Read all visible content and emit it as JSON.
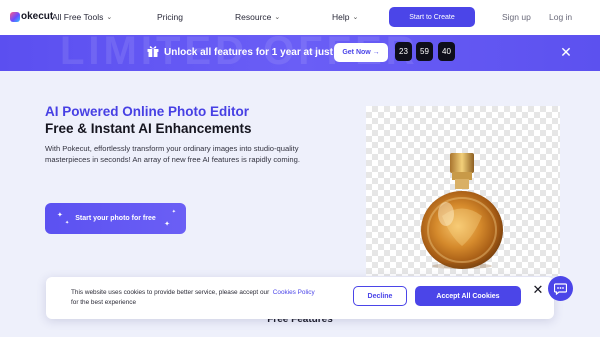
{
  "nav": {
    "logo_text": "okecut",
    "tools_label": "All Free Tools",
    "pricing_label": "Pricing",
    "resource_label": "Resource",
    "help_label": "Help",
    "create_label": "Start to Create",
    "signup_label": "Sign up",
    "login_label": "Log in"
  },
  "promo": {
    "ghost_text": "LIMITED OFFER",
    "text": "Unlock all features for 1 year at just $1!",
    "button_label": "Get Now →",
    "countdown": [
      "23",
      "59",
      "40"
    ]
  },
  "hero": {
    "title": "AI Powered Online Photo Editor",
    "subtitle": "Free & Instant AI Enhancements",
    "description": "With Pokecut, effortlessly transform your ordinary images into studio-quality masterpieces in seconds! An array of new free AI features is rapidly coming.",
    "start_label": "Start your photo for free"
  },
  "features_title": "Free Features",
  "cookie": {
    "text_before": "This website uses cookies to provide better service, please accept our",
    "link": "Cookies Policy",
    "text_after": "for the best experience",
    "decline_label": "Decline",
    "accept_label": "Accept All Cookies"
  },
  "colors": {
    "accent": "#4b45e8",
    "banner": "#5b4ff0",
    "page_bg": "#eef0fb"
  }
}
